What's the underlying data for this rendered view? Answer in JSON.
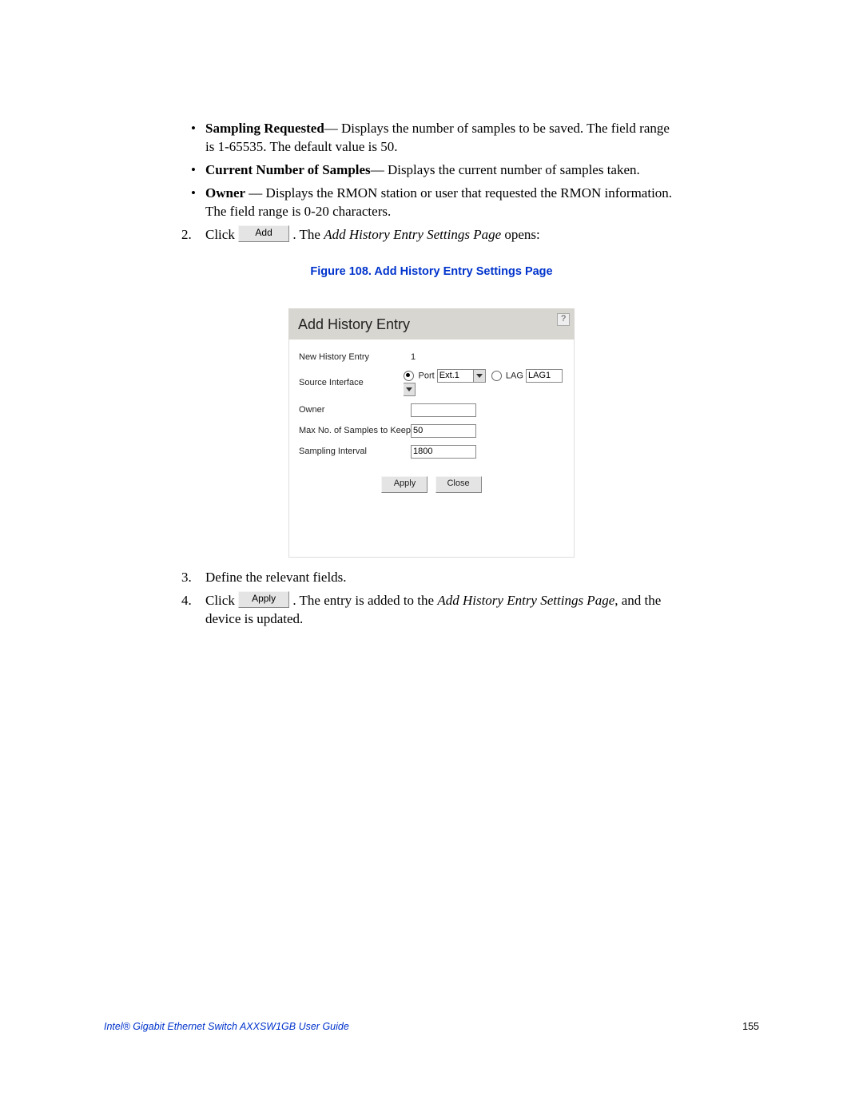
{
  "bullets": [
    {
      "label": "Sampling Requested",
      "text": "— Displays the number of samples to be saved. The field range is 1-65535. The default value is 50."
    },
    {
      "label": "Current Number of Samples",
      "text": "— Displays the current number of samples taken."
    },
    {
      "label": "Owner",
      "text": " — Displays the RMON station or user that requested the RMON information. The field range is 0-20 characters."
    }
  ],
  "step2": {
    "num": "2.",
    "prefix": "Click ",
    "btn": "Add",
    "mid": ". The ",
    "italic": "Add History Entry Settings Page",
    "suffix": " opens:"
  },
  "figure_caption": "Figure 108. Add History Entry Settings Page",
  "dialog": {
    "title": "Add History Entry",
    "help": "?",
    "rows": {
      "new_entry_label": "New History Entry",
      "new_entry_value": "1",
      "source_label": "Source Interface",
      "port_label": "Port",
      "port_value": "Ext.1",
      "lag_label": "LAG",
      "lag_value": "LAG1",
      "owner_label": "Owner",
      "owner_value": "",
      "max_samples_label": "Max No. of Samples to Keep",
      "max_samples_value": "50",
      "interval_label": "Sampling Interval",
      "interval_value": "1800"
    },
    "apply_btn": "Apply",
    "close_btn": "Close"
  },
  "step3": {
    "num": "3.",
    "text": "Define the relevant fields."
  },
  "step4": {
    "num": "4.",
    "prefix": "Click ",
    "btn": "Apply",
    "mid": ". The entry is added to the ",
    "italic": "Add History Entry Settings Page",
    "suffix": ", and the device is updated."
  },
  "footer_left": "Intel® Gigabit Ethernet Switch AXXSW1GB User Guide",
  "footer_right": "155"
}
